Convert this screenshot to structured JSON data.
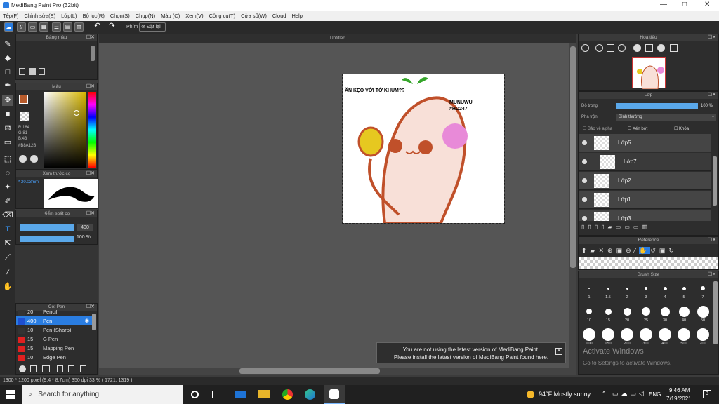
{
  "window": {
    "title": "MediBang Paint Pro (32bit)",
    "min": "—",
    "max": "□",
    "close": "✕"
  },
  "menu": [
    "Tệp(F)",
    "Chỉnh sửa(E)",
    "Lớp(L)",
    "Bộ lọc(R)",
    "Chọn(S)",
    "Chụp(N)",
    "Màu (C)",
    "Xem(V)",
    "Công cụ(T)",
    "Cửa sổ(W)",
    "Cloud",
    "Help"
  ],
  "toolbar": {
    "shortcut_label": "Phím",
    "reset_label": "Đặt lại"
  },
  "panels": {
    "color_palette": "Bảng màu",
    "color": "Màu",
    "preview": "Xem trước cọ",
    "brush_control": "Kiểm soát cọ",
    "brush_list": "Cọ: Pen",
    "navigator": "Hoa tiêu",
    "layer": "Lớp",
    "reference": "Reference",
    "brush_size": "Brush Size"
  },
  "color_info": {
    "r": "R:184",
    "g": "G:81",
    "b": "B:43",
    "hex": "#B8A12B",
    "accent": "#b85b2b"
  },
  "brush_preview": {
    "size": "* 20.03mm"
  },
  "brush_control": {
    "size": "400",
    "opacity": "100 %"
  },
  "brushes": [
    {
      "size": "20",
      "name": "Pencil",
      "color": "#333333"
    },
    {
      "size": "400",
      "name": "Pen",
      "color": "#1e4fd1",
      "selected": true
    },
    {
      "size": "10",
      "name": "Pen (Sharp)",
      "color": "#333333"
    },
    {
      "size": "15",
      "name": "G Pen",
      "color": "#e02020"
    },
    {
      "size": "15",
      "name": "Mapping Pen",
      "color": "#e02020"
    },
    {
      "size": "10",
      "name": "Edge Pen",
      "color": "#e02020"
    }
  ],
  "canvas": {
    "tab": "Untitled"
  },
  "drawing_text": {
    "line1": "ĂN KẸO VỚI TỚ KHUM??",
    "line2": "MUNUWU",
    "line3": "#HD247"
  },
  "layer_panel": {
    "opacity_label": "Độ trong",
    "opacity_value": "100 %",
    "blend_label": "Pha trộn",
    "blend_value": "Bình thường",
    "protect_alpha": "Bảo vệ alpha",
    "clipping": "Xén bớt",
    "lock": "Khóa",
    "layers": [
      "Lớp5",
      "Lớp7",
      "Lớp2",
      "Lớp1",
      "Lớp3"
    ]
  },
  "brush_sizes": [
    "1",
    "1.5",
    "2",
    "3",
    "4",
    "5",
    "7",
    "10",
    "15",
    "20",
    "25",
    "30",
    "40",
    "50",
    "100",
    "150",
    "200",
    "300",
    "400",
    "500",
    "700"
  ],
  "notification": {
    "line1": "You are not using the latest version of MediBang Paint.",
    "line2": "Please install the latest version of MediBang Paint found here."
  },
  "watermark": {
    "line1": "Activate Windows",
    "line2": "Go to Settings to activate Windows."
  },
  "status": "1300 * 1200 pixel  (9.4 * 8.7cm)  350 dpi  33 %  ( 1721, 1319 )",
  "taskbar": {
    "search": "Search for anything",
    "weather": "94°F  Mostly sunny",
    "lang": "ENG",
    "time": "9:46 AM",
    "date": "7/19/2021"
  }
}
